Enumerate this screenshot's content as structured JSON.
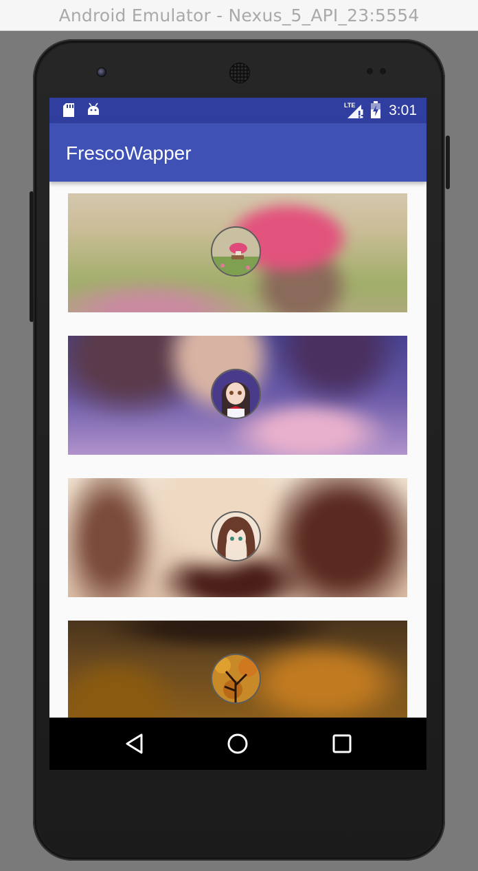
{
  "window": {
    "title": "Android Emulator - Nexus_5_API_23:5554"
  },
  "status_bar": {
    "time": "3:01",
    "network_label": "LTE",
    "icons": [
      "sd-card-icon",
      "android-debug-icon",
      "lte-signal-icon",
      "battery-charging-icon"
    ]
  },
  "app_bar": {
    "title": "FrescoWapper"
  },
  "cards": [
    {
      "name": "mushroom-card",
      "avatar_icon": "mushroom-house-avatar"
    },
    {
      "name": "anime-girl-red-bow-card",
      "avatar_icon": "anime-girl-red-bow-avatar"
    },
    {
      "name": "anime-girl-brown-hair-card",
      "avatar_icon": "anime-girl-brown-hair-avatar"
    },
    {
      "name": "autumn-tree-card",
      "avatar_icon": "autumn-tree-avatar"
    }
  ],
  "nav_bar": {
    "buttons": [
      "back-icon",
      "home-icon",
      "recents-icon"
    ]
  },
  "colors": {
    "status_bar": "#303f9f",
    "app_bar": "#3f51b5",
    "screen_bg": "#fafafa",
    "nav_bar": "#000000"
  }
}
